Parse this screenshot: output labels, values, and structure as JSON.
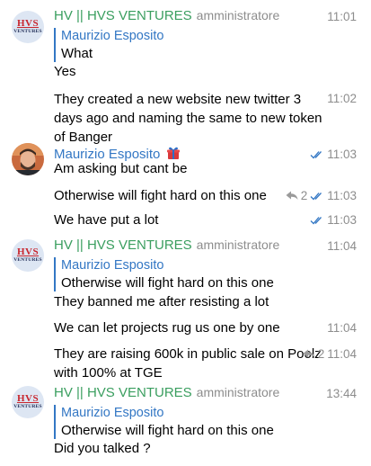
{
  "messages": {
    "g1": {
      "sender": "HV || HVS VENTURES",
      "role": "amministratore",
      "time": "11:01",
      "reply_name": "Maurizio Esposito",
      "reply_text": "What",
      "line1": "Yes",
      "msg2": "They created a new website new twitter 3 days ago and naming the same to new token of Banger",
      "msg2_time": "11:02"
    },
    "g2": {
      "sender": "Maurizio Esposito",
      "time": "11:03",
      "line1": "Am asking but cant be",
      "line2": "Otherwise will fight hard on this one",
      "line2_replies": "2",
      "line2_time": "11:03",
      "line3": "We have put a lot",
      "line3_time": "11:03"
    },
    "g3": {
      "sender": "HV || HVS VENTURES",
      "role": "amministratore",
      "time": "11:04",
      "reply_name": "Maurizio Esposito",
      "reply_text": "Otherwise will fight hard on this one",
      "line1": "They banned me after resisting a lot",
      "line2": "We can let projects rug us one by one",
      "line2_time": "11:04",
      "msg3": "They are raising 600k in public sale on Poolz with 100% at TGE",
      "msg3_replies": "2",
      "msg3_time": "11:04"
    },
    "g4": {
      "sender": "HV || HVS VENTURES",
      "role": "amministratore",
      "time": "13:44",
      "reply_name": "Maurizio Esposito",
      "reply_text": "Otherwise will fight hard on this one",
      "line1": "Did you talked ?"
    }
  },
  "logo": {
    "top": "HVS",
    "bottom": "VENTURES"
  },
  "colors": {
    "sender_green": "#3a9e5f",
    "link_blue": "#3377c4",
    "meta_gray": "#8d8d8d"
  }
}
